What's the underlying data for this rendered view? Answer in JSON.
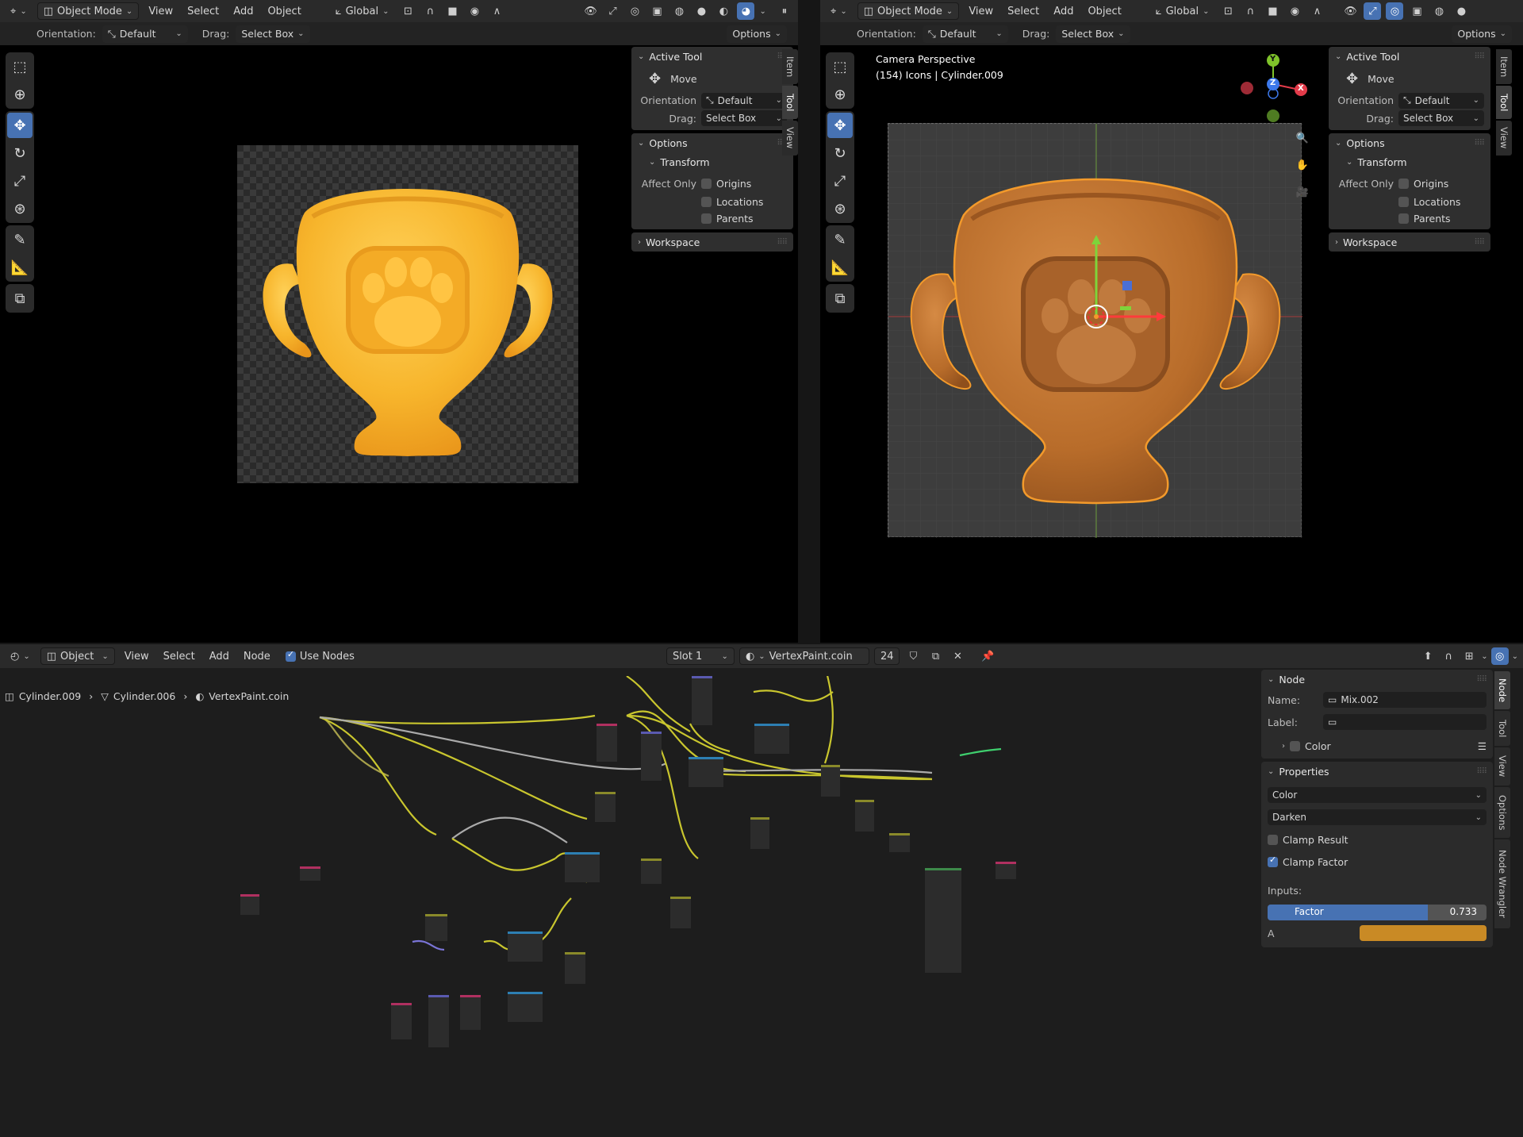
{
  "left_viewport": {
    "header": {
      "mode": "Object Mode",
      "menus": [
        "View",
        "Select",
        "Add",
        "Object"
      ],
      "transform": "Global"
    },
    "tool_settings": {
      "orientation_label": "Orientation:",
      "orientation_value": "Default",
      "drag_label": "Drag:",
      "drag_value": "Select Box",
      "options": "Options"
    },
    "npanel": {
      "active_tool": "Active Tool",
      "tool_name": "Move",
      "orientation_label": "Orientation",
      "orientation_value": "Default",
      "drag_label": "Drag:",
      "drag_value": "Select Box",
      "options": "Options",
      "transform": "Transform",
      "affect_only": "Affect Only",
      "origins": "Origins",
      "locations": "Locations",
      "parents": "Parents",
      "workspace": "Workspace"
    },
    "tabs": [
      "Item",
      "Tool",
      "View"
    ]
  },
  "right_viewport": {
    "header": {
      "mode": "Object Mode",
      "menus": [
        "View",
        "Select",
        "Add",
        "Object"
      ],
      "transform": "Global"
    },
    "tool_settings": {
      "orientation_label": "Orientation:",
      "orientation_value": "Default",
      "drag_label": "Drag:",
      "drag_value": "Select Box",
      "options": "Options"
    },
    "overlay_text": {
      "line1": "Camera Perspective",
      "line2": "(154) Icons | Cylinder.009"
    },
    "gizmo": {
      "y": "Y",
      "z": "Z",
      "x": "X"
    },
    "npanel": {
      "active_tool": "Active Tool",
      "tool_name": "Move",
      "orientation_label": "Orientation",
      "orientation_value": "Default",
      "drag_label": "Drag:",
      "drag_value": "Select Box",
      "options": "Options",
      "transform": "Transform",
      "affect_only": "Affect Only",
      "origins": "Origins",
      "locations": "Locations",
      "parents": "Parents",
      "workspace": "Workspace"
    },
    "tabs": [
      "Item",
      "Tool",
      "View"
    ]
  },
  "node_editor": {
    "header": {
      "type": "Object",
      "menus": [
        "View",
        "Select",
        "Add",
        "Node"
      ],
      "use_nodes": "Use Nodes",
      "slot": "Slot 1",
      "material": "VertexPaint.coin",
      "users": "24"
    },
    "breadcrumb": [
      "Cylinder.009",
      "Cylinder.006",
      "VertexPaint.coin"
    ],
    "sidebar": {
      "node_title": "Node",
      "name_label": "Name:",
      "name_value": "Mix.002",
      "label_label": "Label:",
      "label_value": "",
      "color_section": "Color",
      "properties_title": "Properties",
      "data_type": "Color",
      "blend_mode": "Darken",
      "clamp_result": "Clamp Result",
      "clamp_factor": "Clamp Factor",
      "inputs_label": "Inputs:",
      "factor_label": "Factor",
      "factor_value": "0.733",
      "factor_fraction": 0.733,
      "a_label": "A",
      "a_color": "#c98a25"
    },
    "tabs": [
      "Node",
      "Tool",
      "View",
      "Options",
      "Node Wrangler"
    ]
  },
  "colors": {
    "accent": "#4772b3",
    "trophy_render": "#f7b52c",
    "trophy_solid": "#b86c2a",
    "selection_outline": "#f39a2b"
  }
}
